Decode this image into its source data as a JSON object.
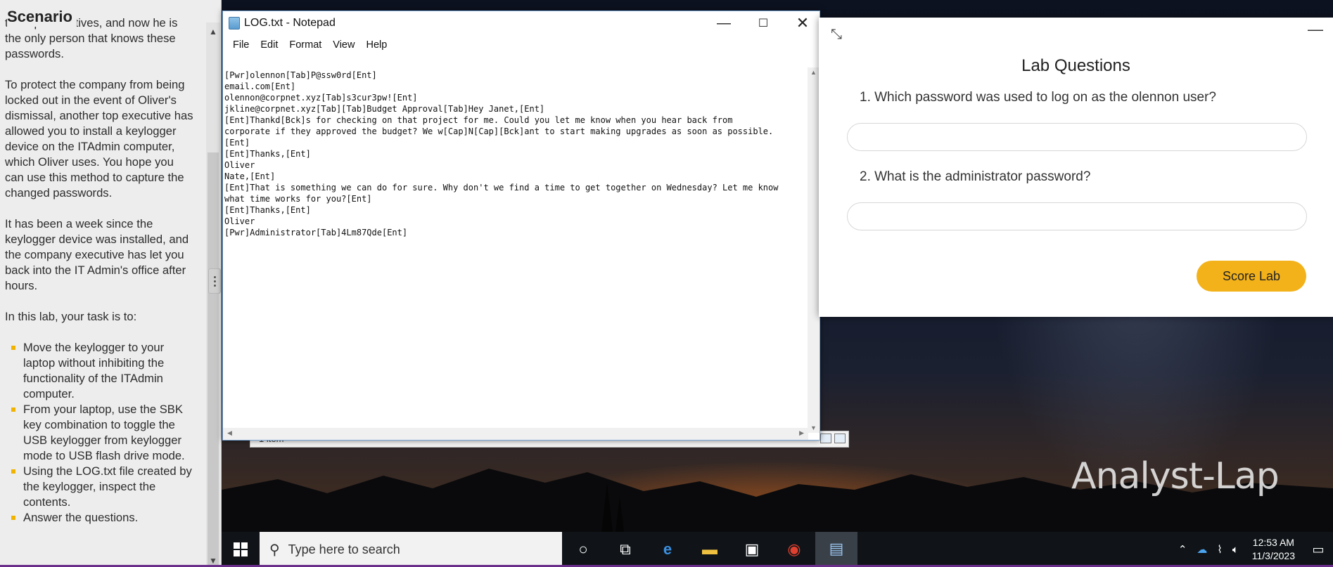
{
  "scenario": {
    "title": "Scenario",
    "partial_top": "the top executives, and now he is",
    "para1_rest": "the only person that knows these passwords.",
    "para2": "To protect the company from being locked out in the event of Oliver's dismissal, another top executive has allowed you to install a keylogger device on the ITAdmin computer, which Oliver uses. You hope you can use this method to capture the changed passwords.",
    "para3": "It has been a week since the keylogger device was installed, and the company executive has let you back into the IT Admin's office after hours.",
    "para4": "In this lab, your task is to:",
    "tasks": [
      "Move the keylogger to your laptop without inhibiting the functionality of the ITAdmin computer.",
      "From your laptop, use the SBK key combination to toggle the USB keylogger from keylogger mode to USB flash drive mode.",
      "Using the LOG.txt file created by the keylogger, inspect the contents.",
      "Answer the questions."
    ]
  },
  "notepad": {
    "title": "LOG.txt - Notepad",
    "menu": [
      "File",
      "Edit",
      "Format",
      "View",
      "Help"
    ],
    "content": "[Pwr]olennon[Tab]P@ssw0rd[Ent]\nemail.com[Ent]\nolennon@corpnet.xyz[Tab]s3cur3pw![Ent]\njkline@corpnet.xyz[Tab][Tab]Budget Approval[Tab]Hey Janet,[Ent]\n[Ent]Thankd[Bck]s for checking on that project for me. Could you let me know when you hear back from\ncorporate if they approved the budget? We w[Cap]N[Cap][Bck]ant to start making upgrades as soon as possible.\n[Ent]\n[Ent]Thanks,[Ent]\nOliver\nNate,[Ent]\n[Ent]That is something we can do for sure. Why don't we find a time to get together on Wednesday? Let me know\nwhat time works for you?[Ent]\n[Ent]Thanks,[Ent]\nOliver\n[Pwr]Administrator[Tab]4Lm87Qde[Ent]",
    "minimize": "—",
    "maximize": "☐",
    "close": "✕"
  },
  "explorer": {
    "status": "1 item"
  },
  "lab": {
    "title": "Lab Questions",
    "q1": "1. Which password was used to log on as the olennon user?",
    "a1": "",
    "q2": "2. What is the administrator password?",
    "a2": "",
    "score_label": "Score Lab",
    "collapse_icon": "⤡",
    "minimize_icon": "—"
  },
  "desktop": {
    "label": "Analyst-Lap"
  },
  "taskbar": {
    "search_placeholder": "Type here to search",
    "time": "12:53 AM",
    "date": "11/3/2023"
  },
  "colors": {
    "accent": "#f3b21a",
    "bullet": "#f0b400",
    "taskbar": "#101418"
  }
}
